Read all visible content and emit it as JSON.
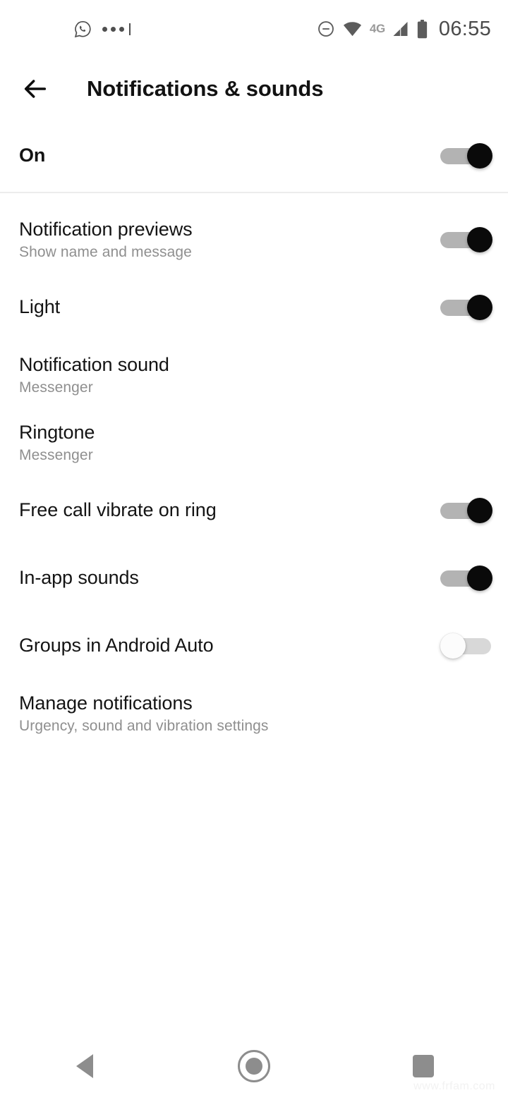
{
  "status_bar": {
    "time": "06:55",
    "network_type": "4G",
    "icons": [
      "whatsapp-icon",
      "overflow-dots-icon",
      "do-not-disturb-icon",
      "wifi-icon",
      "signal-icon",
      "battery-icon"
    ]
  },
  "app_bar": {
    "back_label": "Back",
    "title": "Notifications & sounds"
  },
  "rows": [
    {
      "title": "On",
      "subtitle": "",
      "toggle": "on",
      "name": "master"
    },
    {
      "title": "Notification previews",
      "subtitle": "Show name and message",
      "toggle": "on",
      "name": "notification-previews"
    },
    {
      "title": "Light",
      "subtitle": "",
      "toggle": "on",
      "name": "light"
    },
    {
      "title": "Notification sound",
      "subtitle": "Messenger",
      "toggle": "none",
      "name": "notification-sound"
    },
    {
      "title": "Ringtone",
      "subtitle": "Messenger",
      "toggle": "none",
      "name": "ringtone"
    },
    {
      "title": "Free call vibrate on ring",
      "subtitle": "",
      "toggle": "on",
      "name": "free-call-vibrate-on-ring"
    },
    {
      "title": "In-app sounds",
      "subtitle": "",
      "toggle": "on",
      "name": "in-app-sounds"
    },
    {
      "title": "Groups in Android Auto",
      "subtitle": "",
      "toggle": "off",
      "name": "groups-in-android-auto"
    },
    {
      "title": "Manage notifications",
      "subtitle": "Urgency, sound and vibration settings",
      "toggle": "none",
      "name": "manage-notifications"
    }
  ],
  "nav_bar": {
    "back": "back-nav-button",
    "home": "home-nav-button",
    "recents": "recents-nav-button"
  },
  "watermark": "www.frfam.com",
  "colors": {
    "background": "#ffffff",
    "title_text": "#141414",
    "subtitle_text": "#8f8f8f",
    "toggle_on_thumb": "#0a0a0a",
    "toggle_on_track": "#b3b3b3",
    "toggle_off_track": "#d8d8d8",
    "divider": "#ececec",
    "nav_icon": "#8d8d8d"
  }
}
